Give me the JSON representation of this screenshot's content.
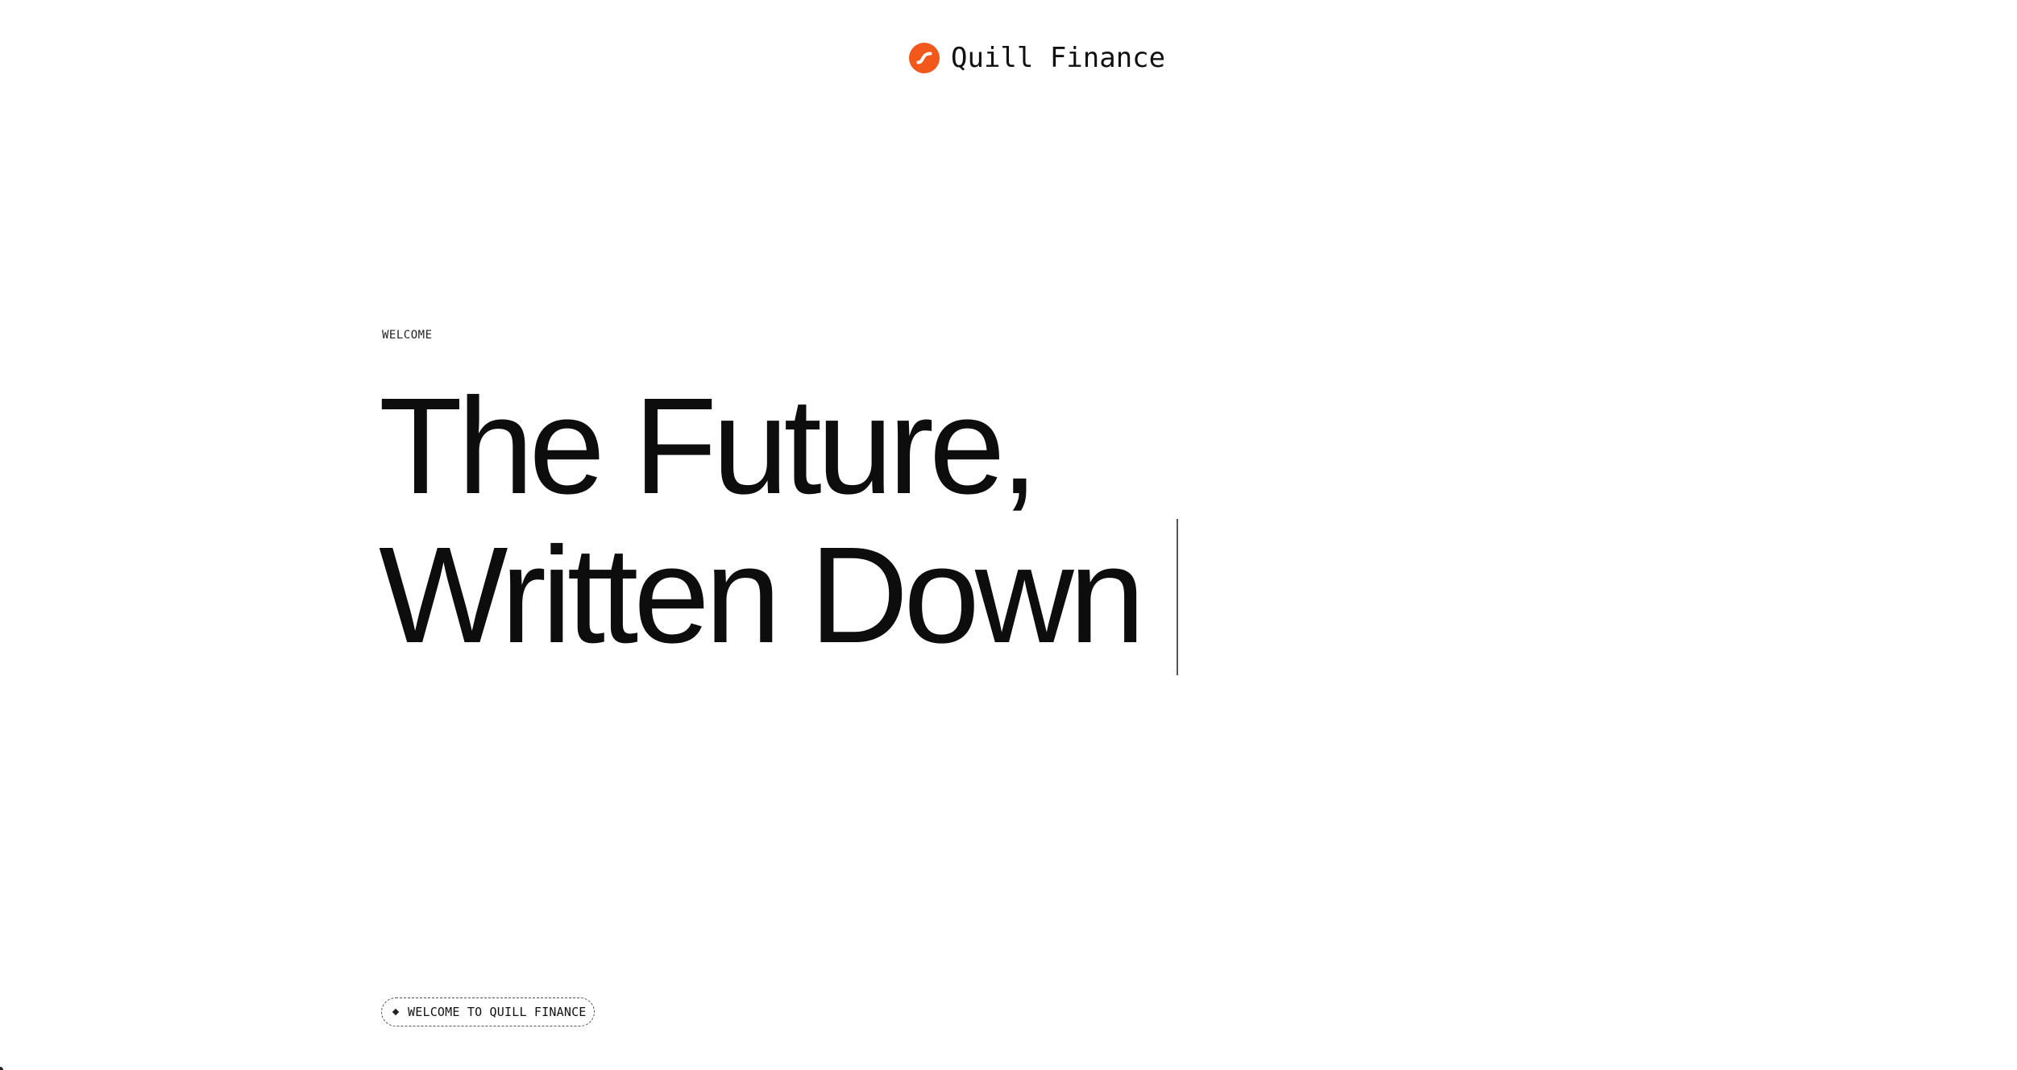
{
  "brand": {
    "name": "Quill Finance",
    "logo_icon": "quill-swoosh-icon",
    "logo_color": "#F2581B"
  },
  "hero": {
    "eyebrow": "WELCOME",
    "headline_line1": "The Future,",
    "headline_line2": "Written Down"
  },
  "cta_pill": {
    "icon": "diamond-bullet-icon",
    "label": "WELCOME TO QUILL FINANCE"
  },
  "colors": {
    "background": "#FFFFFF",
    "text": "#111111",
    "accent": "#F2581B"
  }
}
